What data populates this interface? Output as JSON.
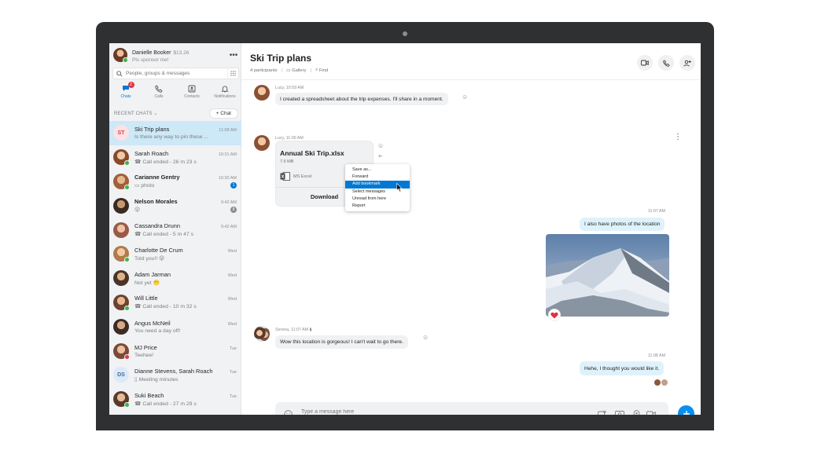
{
  "profile": {
    "name": "Danielle Booker",
    "credit": "$13.26",
    "mood": "Pls sponsor me!"
  },
  "search": {
    "placeholder": "People, groups & messages"
  },
  "nav": [
    {
      "label": "Chats",
      "icon": "chat-icon",
      "badge": "2"
    },
    {
      "label": "Calls",
      "icon": "phone-icon"
    },
    {
      "label": "Contacts",
      "icon": "contacts-icon"
    },
    {
      "label": "Notifications",
      "icon": "bell-icon"
    }
  ],
  "recent": {
    "label": "RECENT CHATS",
    "new_chat_label": "+ Chat"
  },
  "chats": [
    {
      "name": "Ski Trip plans",
      "time": "11:08 AM",
      "preview": "Is there any way to pin these ...",
      "initials": "ST"
    },
    {
      "name": "Sarah Roach",
      "time": "10:31 AM",
      "preview": "Call ended - 26 m 23 s"
    },
    {
      "name": "Carianne Gentry",
      "time": "10:30 AM",
      "preview": "photo",
      "badge": "1"
    },
    {
      "name": "Nelson Morales",
      "time": "9:42 AM",
      "preview": "",
      "badge": "8"
    },
    {
      "name": "Cassandra Drunn",
      "time": "9:42 AM",
      "preview": "Call ended - 5 m 47 s"
    },
    {
      "name": "Charlotte De Crum",
      "time": "Wed",
      "preview": "Told you!!"
    },
    {
      "name": "Adam Jarman",
      "time": "Wed",
      "preview": "Not yet"
    },
    {
      "name": "Will Little",
      "time": "Wed",
      "preview": "Call ended - 10 m 32 s"
    },
    {
      "name": "Angus McNeil",
      "time": "Wed",
      "preview": "You need a day off!"
    },
    {
      "name": "MJ Price",
      "time": "Tue",
      "preview": "Teehee!"
    },
    {
      "name": "Dianne Stevens, Sarah Roach",
      "time": "Tue",
      "preview": "Meeting minutes",
      "initials": "DS"
    },
    {
      "name": "Suki Beach",
      "time": "Tue",
      "preview": "Call ended - 27 m 29 s"
    }
  ],
  "conversation": {
    "title": "Ski Trip plans",
    "participants": "4 participants",
    "gallery_label": "Gallery",
    "find_label": "Find"
  },
  "messages": [
    {
      "meta": "Lucy, 10:59 AM",
      "text": "I created a spreadsheet about the trip expenses. I'll share in a moment."
    },
    {
      "meta": "Lucy, 11:00 AM"
    },
    {
      "meta": "11:07 AM",
      "text": "I also have photos of the location"
    },
    {
      "meta": "Serena, 11:07 AM",
      "text": "Wow this location is gorgeous! I can't wait to go there."
    },
    {
      "meta": "11:08 AM",
      "text": "Hehe, I thought you would like it."
    }
  ],
  "file": {
    "name": "Annual Ski Trip.xlsx",
    "size": "7.6 MB",
    "type": "MS Excel",
    "download_label": "Download"
  },
  "context_menu": [
    "Save as...",
    "Forward",
    "Add bookmark",
    "Select messages",
    "Unread from here",
    "Report"
  ],
  "composer": {
    "placeholder": "Type a message here"
  },
  "colors": {
    "accent": "#0078d4",
    "selected": "#cde8f7",
    "outgoing": "#dff2fc",
    "incoming": "#f0f1f3"
  }
}
